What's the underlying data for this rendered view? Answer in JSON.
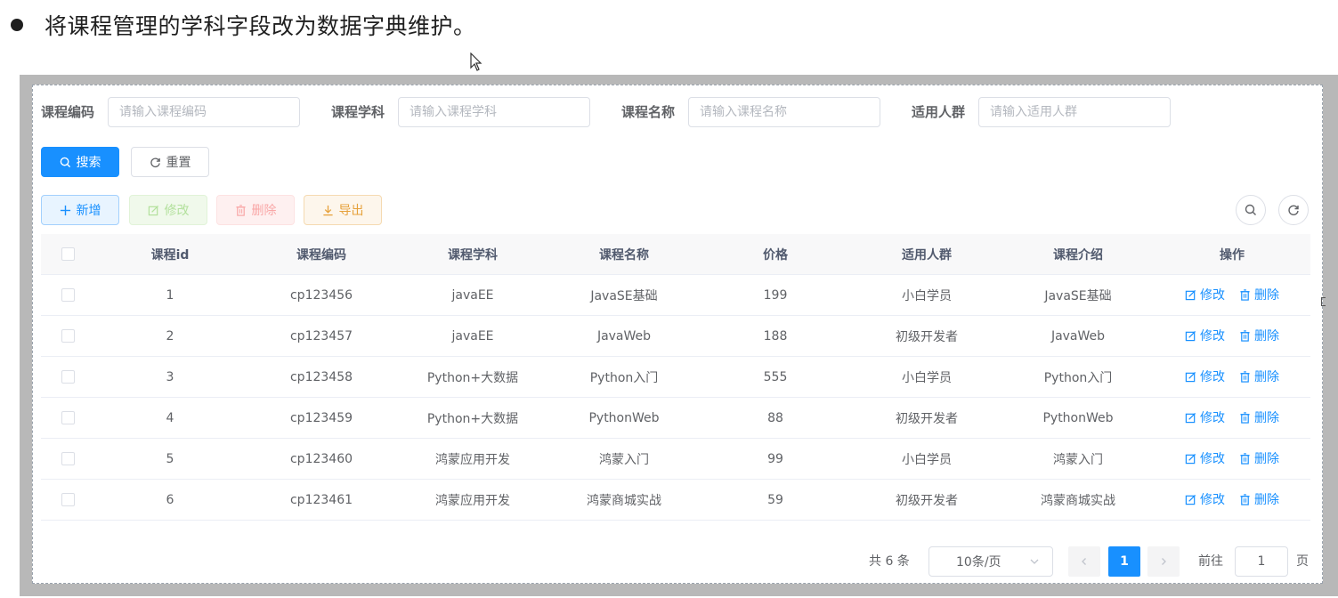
{
  "heading": {
    "text": "将课程管理的学科字段改为数据字典维护。"
  },
  "search_form": {
    "fields": [
      {
        "label": "课程编码",
        "placeholder": "请输入课程编码"
      },
      {
        "label": "课程学科",
        "placeholder": "请输入课程学科"
      },
      {
        "label": "课程名称",
        "placeholder": "请输入课程名称"
      },
      {
        "label": "适用人群",
        "placeholder": "请输入适用人群"
      }
    ],
    "search_label": "搜索",
    "reset_label": "重置"
  },
  "toolbar": {
    "add_label": "新增",
    "edit_label": "修改",
    "delete_label": "删除",
    "export_label": "导出"
  },
  "table": {
    "headers": [
      "课程id",
      "课程编码",
      "课程学科",
      "课程名称",
      "价格",
      "适用人群",
      "课程介绍",
      "操作"
    ],
    "rows": [
      {
        "id": "1",
        "code": "cp123456",
        "subject": "javaEE",
        "name": "JavaSE基础",
        "price": "199",
        "audience": "小白学员",
        "intro": "JavaSE基础"
      },
      {
        "id": "2",
        "code": "cp123457",
        "subject": "javaEE",
        "name": "JavaWeb",
        "price": "188",
        "audience": "初级开发者",
        "intro": "JavaWeb"
      },
      {
        "id": "3",
        "code": "cp123458",
        "subject": "Python+大数据",
        "name": "Python入门",
        "price": "555",
        "audience": "小白学员",
        "intro": "Python入门"
      },
      {
        "id": "4",
        "code": "cp123459",
        "subject": "Python+大数据",
        "name": "PythonWeb",
        "price": "88",
        "audience": "初级开发者",
        "intro": "PythonWeb"
      },
      {
        "id": "5",
        "code": "cp123460",
        "subject": "鸿蒙应用开发",
        "name": "鸿蒙入门",
        "price": "99",
        "audience": "小白学员",
        "intro": "鸿蒙入门"
      },
      {
        "id": "6",
        "code": "cp123461",
        "subject": "鸿蒙应用开发",
        "name": "鸿蒙商城实战",
        "price": "59",
        "audience": "初级开发者",
        "intro": "鸿蒙商城实战"
      }
    ],
    "row_edit_label": "修改",
    "row_delete_label": "删除"
  },
  "pagination": {
    "total_text": "共 6 条",
    "page_size_text": "10条/页",
    "current_page": "1",
    "goto_label": "前往",
    "goto_value": "1",
    "page_suffix": "页"
  },
  "colors": {
    "primary": "#1890ff",
    "success_light": "#b3e19d",
    "danger_light": "#f9a7a7",
    "warning": "#e6a23c"
  },
  "icons": [
    "search-icon",
    "refresh-icon",
    "plus-icon",
    "edit-icon",
    "trash-icon",
    "download-icon",
    "chevron-left-icon",
    "chevron-right-icon",
    "chevron-down-icon",
    "cursor-icon"
  ]
}
